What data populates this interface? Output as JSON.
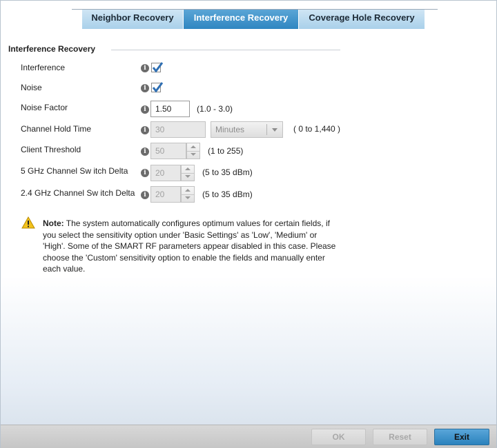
{
  "tabs": [
    {
      "label": "Neighbor Recovery",
      "active": false
    },
    {
      "label": "Interference Recovery",
      "active": true
    },
    {
      "label": "Coverage Hole Recovery",
      "active": false
    }
  ],
  "section": {
    "title": "Interference Recovery"
  },
  "fields": {
    "interference": {
      "label": "Interference",
      "checked": true
    },
    "noise": {
      "label": "Noise",
      "checked": true
    },
    "noise_factor": {
      "label": "Noise Factor",
      "value": "1.50",
      "range": "(1.0 - 3.0)"
    },
    "channel_hold_time": {
      "label": "Channel Hold Time",
      "value": "30",
      "unit": "Minutes",
      "range": "( 0 to 1,440 )",
      "disabled": true
    },
    "client_threshold": {
      "label": "Client Threshold",
      "value": "50",
      "range": "(1 to 255)",
      "disabled": true
    },
    "ghz5_delta": {
      "label": "5 GHz Channel Sw itch Delta",
      "value": "20",
      "range": "(5 to 35 dBm)",
      "disabled": true
    },
    "ghz24_delta": {
      "label": "2.4 GHz Channel Sw itch Delta",
      "value": "20",
      "range": "(5 to 35 dBm)",
      "disabled": true
    }
  },
  "note": {
    "prefix": "Note:",
    "text": " The system automatically configures optimum values for certain fields, if you select the sensitivity option under 'Basic Settings' as 'Low', 'Medium' or 'High'. Some of the SMART RF parameters appear disabled in this case. Please choose the 'Custom' sensitivity option to enable the fields and manually enter each value."
  },
  "footer": {
    "ok_label": "OK",
    "reset_label": "Reset",
    "exit_label": "Exit"
  },
  "icons": {
    "info": "info-icon",
    "warning": "warning-icon",
    "check": "checkmark-icon"
  },
  "colors": {
    "active_tab": "#3a8fc8",
    "inactive_tab": "#b7d9ef",
    "check": "#2f6fb3",
    "warning": "#f2c21b"
  }
}
